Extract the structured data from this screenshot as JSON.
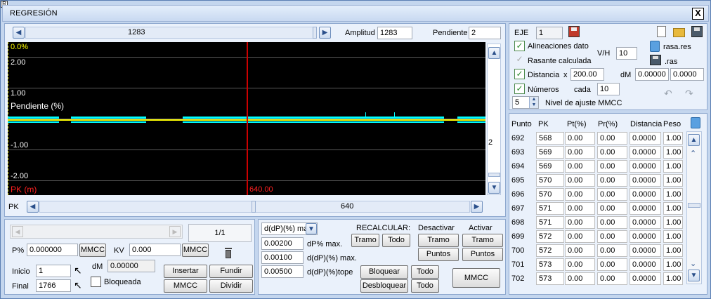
{
  "window": {
    "title": "REGRESIÓN",
    "close_label": "X",
    "sys_label": "R"
  },
  "top_scroll": {
    "value": "1283"
  },
  "amplitud": {
    "label": "Amplitud",
    "value": "1283"
  },
  "pendiente": {
    "label": "Pendiente",
    "value": "2"
  },
  "plot": {
    "y_labels": [
      "0.0%",
      "2.00",
      "1.00",
      "-1.00",
      "-2.00"
    ],
    "title": "Pendiente (%)",
    "xaxis_label": "PK (m)",
    "cursor_label": "640.00",
    "right_label": "2",
    "colors": {
      "background": "#000000",
      "cursor": "#cc0000",
      "line": "#ffff00",
      "segment": "#00ffff"
    }
  },
  "pk_bar": {
    "label": "PK",
    "value": "640"
  },
  "left_bottom": {
    "pager": "1/1",
    "p_label": "P%",
    "p_value": "0.000000",
    "mmcc1": "MMCC",
    "kv_label": "KV",
    "kv_value": "0.000",
    "mmcc2": "MMCC",
    "inicio_label": "Inicio",
    "inicio_value": "1",
    "final_label": "Final",
    "final_value": "1766",
    "dm_label": "dM",
    "dm_value": "0.00000",
    "bloqueada": "Bloqueada",
    "insertar": "Insertar",
    "fundir": "Fundir",
    "mmcc3": "MMCC",
    "dividir": "Dividir"
  },
  "mid_bottom": {
    "select_value": "d(dP)(%) max",
    "v1": "0.00200",
    "l1": "dP% max.",
    "v2": "0.00100",
    "l2": "d(dP)(%) max.",
    "v3": "0.00500",
    "l3": "d(dP)(%)tope",
    "recalcular": "RECALCULAR:",
    "desactivar": "Desactivar",
    "activar": "Activar",
    "tramo1": "Tramo",
    "todo1": "Todo",
    "tramo2": "Tramo",
    "tramo3": "Tramo",
    "puntos1": "Puntos",
    "puntos2": "Puntos",
    "bloquear": "Bloquear",
    "todo2": "Todo",
    "desbloquear": "Desbloquear",
    "todo3": "Todo",
    "mmcc": "MMCC"
  },
  "right_top": {
    "eje_label": "EJE",
    "eje_value": "1",
    "alineaciones": "Alineaciones dato",
    "rasante": "Rasante calculada",
    "vh_label": "V/H",
    "vh_value": "10",
    "rasa_res": "rasa.res",
    "ras": ".ras",
    "distancia": "Distancia",
    "x_label": "x",
    "dist_value": "200.00",
    "dm_label": "dM",
    "dm1": "0.00000",
    "dm2": "0.0000",
    "numeros": "Números",
    "cada_label": "cada",
    "cada_value": "10",
    "nivel_value": "5",
    "nivel_label": "Nivel de ajuste MMCC"
  },
  "table": {
    "headers": [
      "Punto",
      "PK",
      "Pt(%)",
      "Pr(%)",
      "Distancia",
      "Peso"
    ],
    "rows": [
      [
        "692",
        "568",
        "0.00",
        "0.00",
        "0.0000",
        "1.00"
      ],
      [
        "693",
        "569",
        "0.00",
        "0.00",
        "0.0000",
        "1.00"
      ],
      [
        "694",
        "569",
        "0.00",
        "0.00",
        "0.0000",
        "1.00"
      ],
      [
        "695",
        "570",
        "0.00",
        "0.00",
        "0.0000",
        "1.00"
      ],
      [
        "696",
        "570",
        "0.00",
        "0.00",
        "0.0000",
        "1.00"
      ],
      [
        "697",
        "571",
        "0.00",
        "0.00",
        "0.0000",
        "1.00"
      ],
      [
        "698",
        "571",
        "0.00",
        "0.00",
        "0.0000",
        "1.00"
      ],
      [
        "699",
        "572",
        "0.00",
        "0.00",
        "0.0000",
        "1.00"
      ],
      [
        "700",
        "572",
        "0.00",
        "0.00",
        "0.0000",
        "1.00"
      ],
      [
        "701",
        "573",
        "0.00",
        "0.00",
        "0.0000",
        "1.00"
      ],
      [
        "702",
        "573",
        "0.00",
        "0.00",
        "0.0000",
        "1.00"
      ]
    ]
  }
}
